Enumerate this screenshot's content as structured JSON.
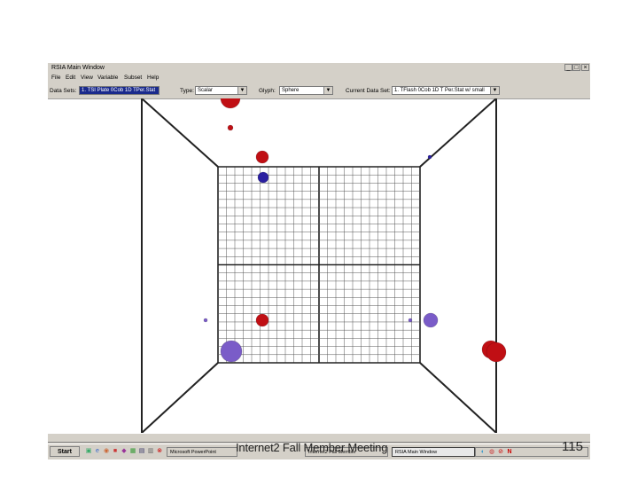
{
  "window": {
    "title": "RSIA Main Window",
    "controls": [
      "_",
      "□",
      "×"
    ]
  },
  "menu": [
    "File",
    "Edit",
    "View",
    "Variable",
    "Subset",
    "Help"
  ],
  "toolbar": {
    "data_sets_label": "Data Sets:",
    "data_sets_value": "1. TSI Plate 0Cob 1D TPer.Stat",
    "type_label": "Type:",
    "type_value": "Scalar",
    "glyph_label": "Glyph:",
    "glyph_value": "Sphere",
    "current_data_set_label": "Current Data Set:",
    "current_data_set_value": "1. TFlash 0Cob 1D T Per.Stat w/ small"
  },
  "scene": {
    "colors": {
      "red": "#c00f14",
      "purple": "#7a5cc8",
      "blue": "#2a1fa0",
      "grid": "#555555",
      "frame": "#222222"
    }
  },
  "taskbar": {
    "start_label": "Start",
    "buttons": [
      "Microsoft PowerPoint",
      "Internet2 Fall Member",
      "RSIA Main Window"
    ],
    "tray_icons": [
      "network-icon",
      "sound-icon",
      "security-icon",
      "norton-icon"
    ]
  },
  "slide": {
    "footer": "Internet2 Fall Member Meeting",
    "page_number": "115"
  }
}
